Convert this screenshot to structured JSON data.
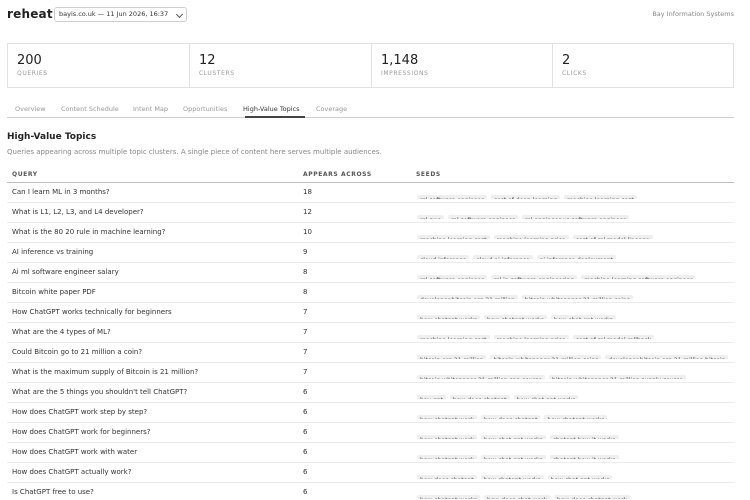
{
  "app": {
    "logo": "reheat",
    "site_selector": "bayis.co.uk — 11 Jun 2026, 16:37",
    "org": "Bay Information Systems"
  },
  "stats": [
    {
      "value": "200",
      "label": "QUERIES"
    },
    {
      "value": "12",
      "label": "CLUSTERS"
    },
    {
      "value": "1,148",
      "label": "IMPRESSIONS"
    },
    {
      "value": "2",
      "label": "CLICKS"
    }
  ],
  "tabs": [
    {
      "label": "Overview"
    },
    {
      "label": "Content Schedule"
    },
    {
      "label": "Intent Map"
    },
    {
      "label": "Opportunities"
    },
    {
      "label": "High-Value Topics",
      "active": true
    },
    {
      "label": "Coverage"
    }
  ],
  "section": {
    "title": "High-Value Topics",
    "description": "Queries appearing across multiple topic clusters. A single piece of content here serves multiple audiences."
  },
  "table": {
    "headers": {
      "query": "QUERY",
      "appears": "APPEARS ACROSS",
      "seeds": "SEEDS"
    },
    "rows": [
      {
        "query": "Can I learn ML in 3 months?",
        "appears": "18",
        "seeds": [
          "ml software engineer",
          "cost of deep learning",
          "machine learning cost"
        ],
        "more": ""
      },
      {
        "query": "What is L1, L2, L3, and L4 developer?",
        "appears": "12",
        "seeds": [
          "ml swe",
          "ml software engineer",
          "ml engineer vs software engineer"
        ],
        "more": ""
      },
      {
        "query": "What is the 80 20 rule in machine learning?",
        "appears": "10",
        "seeds": [
          "machine learning cost",
          "machine learning price",
          "cost of ml model lineage"
        ],
        "more": ""
      },
      {
        "query": "AI inference vs training",
        "appears": "9",
        "seeds": [
          "cloud inference",
          "cloud ai inference",
          "ai inference deployment"
        ],
        "more": ""
      },
      {
        "query": "Ai ml software engineer salary",
        "appears": "8",
        "seeds": [
          "ml software engineer",
          "ml in software engineering",
          "machine learning software engineer"
        ],
        "more": ""
      },
      {
        "query": "Bitcoin white paper PDF",
        "appears": "8",
        "seeds": [
          "developer.bitcoin.org 21 million",
          "bitcoin whitepaper 21 million coins"
        ],
        "more": "..."
      },
      {
        "query": "How ChatGPT works technically for beginners",
        "appears": "7",
        "seeds": [
          "how chatgpt works",
          "how chatgpt works",
          "how chat gpt works"
        ],
        "more": ""
      },
      {
        "query": "What are the 4 types of ML?",
        "appears": "7",
        "seeds": [
          "machine learning cost",
          "machine learning price",
          "cost of ml model rollback"
        ],
        "more": ""
      },
      {
        "query": "Could Bitcoin go to 21 million a coin?",
        "appears": "7",
        "seeds": [
          "bitcoin.org 21 million",
          "bitcoin whitepaper 21 million coins",
          "developer.bitcoin.org 21 million bitcoin"
        ],
        "more": ""
      },
      {
        "query": "What is the maximum supply of Bitcoin is 21 million?",
        "appears": "7",
        "seeds": [
          "bitcoin whitepaper 21 million cap source",
          "bitcoin whitepaper 21 million supply source"
        ],
        "more": "..."
      },
      {
        "query": "What are the 5 things you shouldn't tell ChatGPT?",
        "appears": "6",
        "seeds": [
          "bay gpt",
          "how does chatgpt",
          "how chat gpt works"
        ],
        "more": ""
      },
      {
        "query": "How does ChatGPT work step by step?",
        "appears": "6",
        "seeds": [
          "how chatgpt work",
          "how does chatgpt",
          "how chatgpt works"
        ],
        "more": ""
      },
      {
        "query": "How does ChatGPT work for beginners?",
        "appears": "6",
        "seeds": [
          "how chatgpt work",
          "how chat gpt works",
          "chatgpt how it works"
        ],
        "more": ""
      },
      {
        "query": "How does ChatGPT work with water",
        "appears": "6",
        "seeds": [
          "how chatgpt work",
          "how chat gpt works",
          "chatgpt how it works"
        ],
        "more": ""
      },
      {
        "query": "How does ChatGPT actually work?",
        "appears": "6",
        "seeds": [
          "how does chatgpt",
          "how chatgpt works",
          "how chat gpt works"
        ],
        "more": ""
      },
      {
        "query": "Is ChatGPT free to use?",
        "appears": "6",
        "seeds": [
          "how chatgpt works",
          "how does chat work",
          "how does chatgpt work"
        ],
        "more": ""
      }
    ]
  }
}
